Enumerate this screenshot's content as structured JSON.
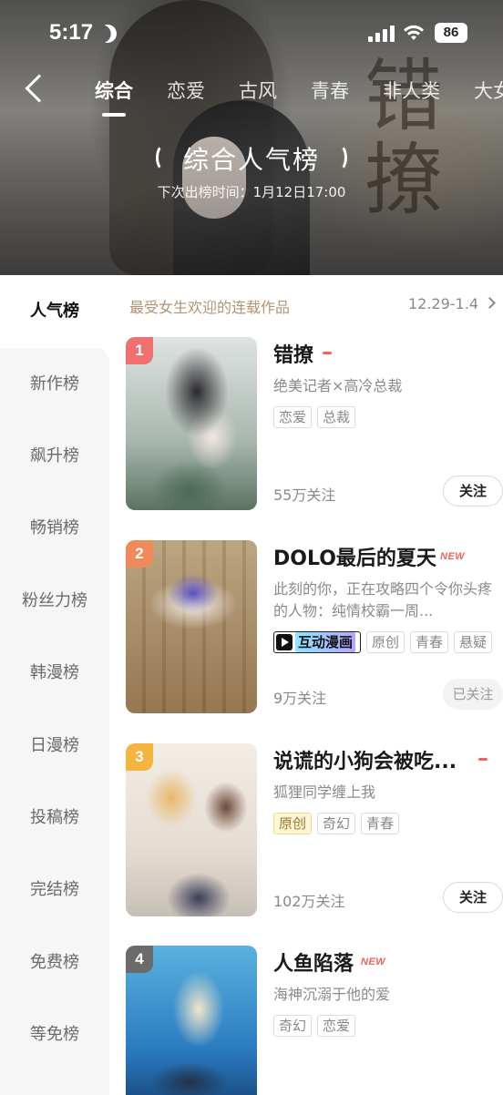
{
  "status_bar": {
    "time": "5:17",
    "battery": "86"
  },
  "nav": {
    "tabs": [
      "综合",
      "恋爱",
      "古风",
      "青春",
      "非人类",
      "大女主"
    ],
    "active_tab": "综合"
  },
  "hero": {
    "title": "综合人气榜",
    "subtitle": "下次出榜时间：1月12日17:00",
    "calligraphy": "错 撩"
  },
  "sidebar": {
    "items": [
      "人气榜",
      "新作榜",
      "飙升榜",
      "畅销榜",
      "粉丝力榜",
      "韩漫榜",
      "日漫榜",
      "投稿榜",
      "完结榜",
      "免费榜",
      "等免榜"
    ],
    "active": "人气榜"
  },
  "section": {
    "title": "最受女生欢迎的连载作品",
    "date_range": "12.29-1.4"
  },
  "comics": [
    {
      "rank": "1",
      "title": "错撩",
      "trend": "same",
      "description": "绝美记者×高冷总裁",
      "tags": [
        "恋爱",
        "总裁"
      ],
      "followers": "55万关注",
      "follow_label": "关注",
      "followed": false,
      "rank_color": "#f07070"
    },
    {
      "rank": "2",
      "title": "DOLO最后的夏天",
      "badge": "NEW",
      "description": "此刻的你，正在攻略四个令你头疼的人物：纯情校霸一周...",
      "interactive_tag": "互动漫画",
      "tags": [
        "原创",
        "青春",
        "悬疑"
      ],
      "followers": "9万关注",
      "follow_label": "已关注",
      "followed": true,
      "rank_color": "#f08a5a"
    },
    {
      "rank": "3",
      "title": "说谎的小狗会被吃...",
      "trend": "same",
      "description": "狐狸同学缠上我",
      "highlight_tag": "原创",
      "tags": [
        "奇幻",
        "青春"
      ],
      "followers": "102万关注",
      "follow_label": "关注",
      "followed": false,
      "rank_color": "#f5b340"
    },
    {
      "rank": "4",
      "title": "人鱼陷落",
      "badge": "NEW",
      "description": "海神沉溺于他的爱",
      "tags": [
        "奇幻",
        "恋爱"
      ],
      "rank_color": "#6b6b6b"
    }
  ]
}
